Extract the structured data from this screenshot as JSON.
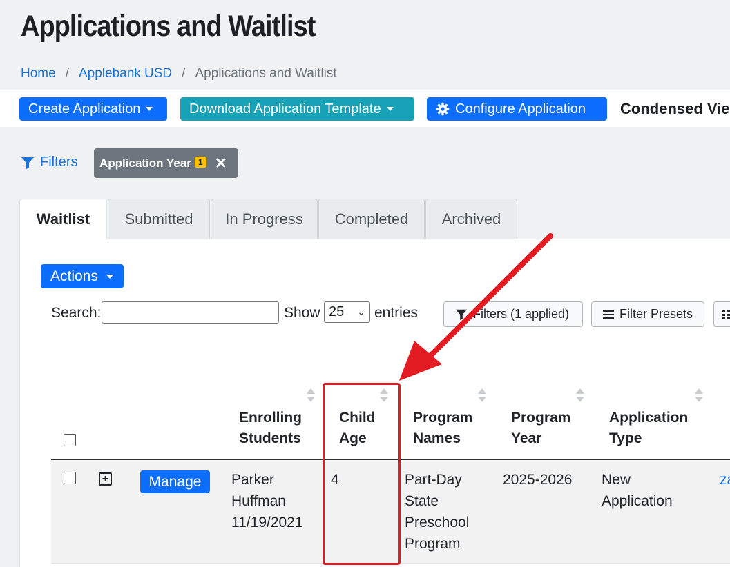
{
  "page": {
    "title": "Applications and Waitlist",
    "breadcrumb": [
      "Home",
      "Applebank USD",
      "Applications and Waitlist"
    ]
  },
  "toolbar": {
    "create_label": "Create Application",
    "download_label": "Download Application Template",
    "configure_label": "Configure Application",
    "condensed_label": "Condensed Vie"
  },
  "filters": {
    "link_label": "Filters",
    "chip_label": "Application Year",
    "chip_count": "1"
  },
  "tabs": [
    "Waitlist",
    "Submitted",
    "In Progress",
    "Completed",
    "Archived"
  ],
  "table_controls": {
    "actions_label": "Actions",
    "search_label": "Search:",
    "show_label": "Show",
    "entries_value": "25",
    "entries_label": "entries",
    "filters_applied_label": "Filters (1 applied)",
    "presets_label": "Filter Presets"
  },
  "table": {
    "headers": {
      "enrolling": [
        "Enrolling",
        "Students"
      ],
      "age": [
        "Child",
        "Age"
      ],
      "program_names": [
        "Program",
        "Names"
      ],
      "program_year": [
        "Program",
        "Year"
      ],
      "application_type": [
        "Application",
        "Type"
      ]
    },
    "row": {
      "manage_label": "Manage",
      "student": [
        "Parker",
        "Huffman",
        "11/19/2021"
      ],
      "age": "4",
      "program": [
        "Part-Day",
        "State",
        "Preschool",
        "Program"
      ],
      "year": "2025-2026",
      "type": [
        "New",
        "Application"
      ],
      "link": "za"
    }
  },
  "colors": {
    "primary": "#0d6efd",
    "teal": "#17a2b8",
    "chip": "#6c757d",
    "badge": "#ffc107",
    "annotation": "#e31b23"
  }
}
